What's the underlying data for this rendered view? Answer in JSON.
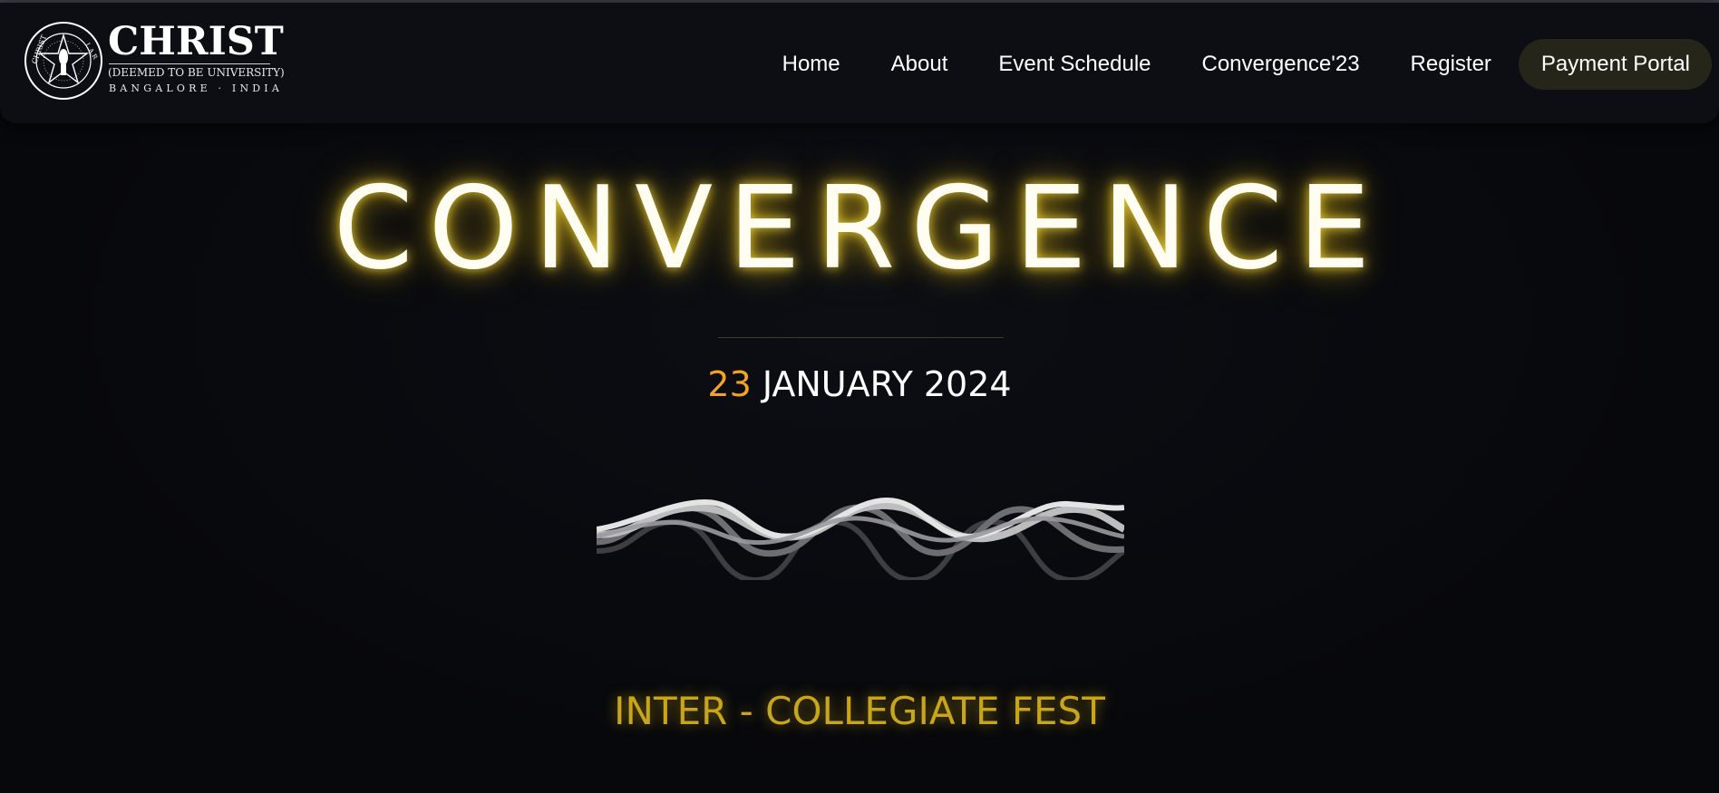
{
  "logo": {
    "name": "CHRIST",
    "subtitle": "(DEEMED TO BE UNIVERSITY)",
    "location": "BANGALORE · INDIA",
    "emblem_text_top": "CHRIST",
    "emblem_text_right": "L.A.R",
    "emblem_text_bottom": "EXCELLENCE AND SERVICE"
  },
  "nav": {
    "items": [
      {
        "label": "Home"
      },
      {
        "label": "About"
      },
      {
        "label": "Event Schedule"
      },
      {
        "label": "Convergence'23"
      },
      {
        "label": "Register"
      }
    ],
    "payment": "Payment Portal"
  },
  "hero": {
    "title": "CONVERGENCE",
    "date_day": "23",
    "date_rest": " JANUARY 2024",
    "tagline": "INTER - COLLEGIATE FEST"
  },
  "colors": {
    "background": "#07080b",
    "navbar": "#0c0e13",
    "accent_gold": "#c9a51a",
    "date_orange": "#f2a324",
    "payment_bg": "#26251a"
  }
}
